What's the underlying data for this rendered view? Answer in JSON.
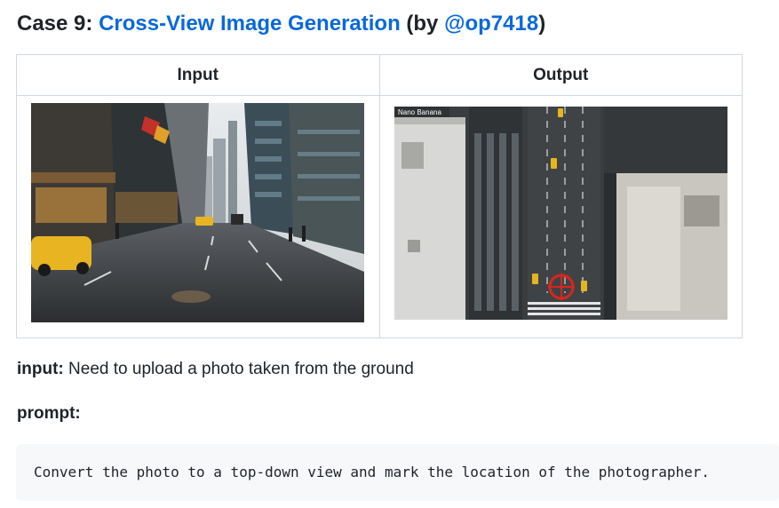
{
  "heading": {
    "prefix": "Case 9:",
    "link_title": "Cross-View Image Generation",
    "by_open": "(by",
    "author": "@op7418",
    "by_close": ")"
  },
  "table": {
    "headers": [
      "Input",
      "Output"
    ],
    "input_image": {
      "description_icon": "street-photo-image"
    },
    "output_image": {
      "watermark": "Nano Banana",
      "marker_color": "#d9261c"
    }
  },
  "input_line": {
    "label": "input:",
    "text": "Need to upload a photo taken from the ground"
  },
  "prompt_label": "prompt:",
  "prompt_text": "Convert the photo to a top-down view and mark the location of the photographer.",
  "colors": {
    "link": "#0969da",
    "border": "#d1d9e0",
    "code_bg": "#f6f8fa"
  }
}
